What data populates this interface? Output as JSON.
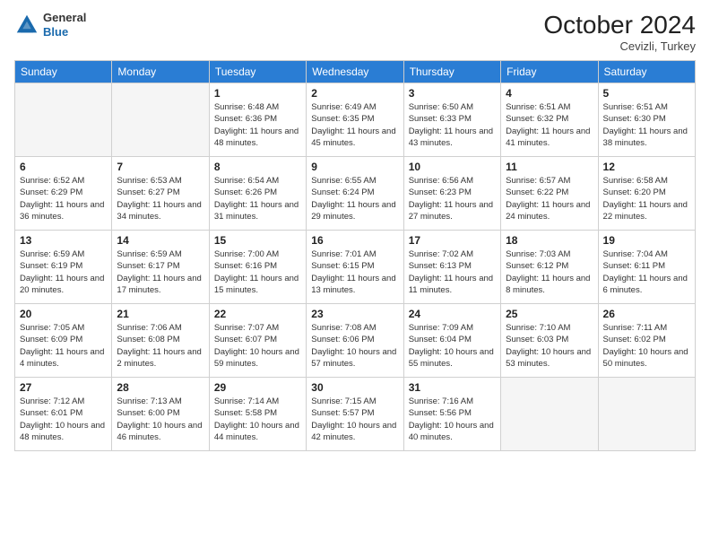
{
  "logo": {
    "general": "General",
    "blue": "Blue"
  },
  "header": {
    "month": "October 2024",
    "location": "Cevizli, Turkey"
  },
  "days_of_week": [
    "Sunday",
    "Monday",
    "Tuesday",
    "Wednesday",
    "Thursday",
    "Friday",
    "Saturday"
  ],
  "weeks": [
    [
      {
        "day": "",
        "info": ""
      },
      {
        "day": "",
        "info": ""
      },
      {
        "day": "1",
        "info": "Sunrise: 6:48 AM\nSunset: 6:36 PM\nDaylight: 11 hours and 48 minutes."
      },
      {
        "day": "2",
        "info": "Sunrise: 6:49 AM\nSunset: 6:35 PM\nDaylight: 11 hours and 45 minutes."
      },
      {
        "day": "3",
        "info": "Sunrise: 6:50 AM\nSunset: 6:33 PM\nDaylight: 11 hours and 43 minutes."
      },
      {
        "day": "4",
        "info": "Sunrise: 6:51 AM\nSunset: 6:32 PM\nDaylight: 11 hours and 41 minutes."
      },
      {
        "day": "5",
        "info": "Sunrise: 6:51 AM\nSunset: 6:30 PM\nDaylight: 11 hours and 38 minutes."
      }
    ],
    [
      {
        "day": "6",
        "info": "Sunrise: 6:52 AM\nSunset: 6:29 PM\nDaylight: 11 hours and 36 minutes."
      },
      {
        "day": "7",
        "info": "Sunrise: 6:53 AM\nSunset: 6:27 PM\nDaylight: 11 hours and 34 minutes."
      },
      {
        "day": "8",
        "info": "Sunrise: 6:54 AM\nSunset: 6:26 PM\nDaylight: 11 hours and 31 minutes."
      },
      {
        "day": "9",
        "info": "Sunrise: 6:55 AM\nSunset: 6:24 PM\nDaylight: 11 hours and 29 minutes."
      },
      {
        "day": "10",
        "info": "Sunrise: 6:56 AM\nSunset: 6:23 PM\nDaylight: 11 hours and 27 minutes."
      },
      {
        "day": "11",
        "info": "Sunrise: 6:57 AM\nSunset: 6:22 PM\nDaylight: 11 hours and 24 minutes."
      },
      {
        "day": "12",
        "info": "Sunrise: 6:58 AM\nSunset: 6:20 PM\nDaylight: 11 hours and 22 minutes."
      }
    ],
    [
      {
        "day": "13",
        "info": "Sunrise: 6:59 AM\nSunset: 6:19 PM\nDaylight: 11 hours and 20 minutes."
      },
      {
        "day": "14",
        "info": "Sunrise: 6:59 AM\nSunset: 6:17 PM\nDaylight: 11 hours and 17 minutes."
      },
      {
        "day": "15",
        "info": "Sunrise: 7:00 AM\nSunset: 6:16 PM\nDaylight: 11 hours and 15 minutes."
      },
      {
        "day": "16",
        "info": "Sunrise: 7:01 AM\nSunset: 6:15 PM\nDaylight: 11 hours and 13 minutes."
      },
      {
        "day": "17",
        "info": "Sunrise: 7:02 AM\nSunset: 6:13 PM\nDaylight: 11 hours and 11 minutes."
      },
      {
        "day": "18",
        "info": "Sunrise: 7:03 AM\nSunset: 6:12 PM\nDaylight: 11 hours and 8 minutes."
      },
      {
        "day": "19",
        "info": "Sunrise: 7:04 AM\nSunset: 6:11 PM\nDaylight: 11 hours and 6 minutes."
      }
    ],
    [
      {
        "day": "20",
        "info": "Sunrise: 7:05 AM\nSunset: 6:09 PM\nDaylight: 11 hours and 4 minutes."
      },
      {
        "day": "21",
        "info": "Sunrise: 7:06 AM\nSunset: 6:08 PM\nDaylight: 11 hours and 2 minutes."
      },
      {
        "day": "22",
        "info": "Sunrise: 7:07 AM\nSunset: 6:07 PM\nDaylight: 10 hours and 59 minutes."
      },
      {
        "day": "23",
        "info": "Sunrise: 7:08 AM\nSunset: 6:06 PM\nDaylight: 10 hours and 57 minutes."
      },
      {
        "day": "24",
        "info": "Sunrise: 7:09 AM\nSunset: 6:04 PM\nDaylight: 10 hours and 55 minutes."
      },
      {
        "day": "25",
        "info": "Sunrise: 7:10 AM\nSunset: 6:03 PM\nDaylight: 10 hours and 53 minutes."
      },
      {
        "day": "26",
        "info": "Sunrise: 7:11 AM\nSunset: 6:02 PM\nDaylight: 10 hours and 50 minutes."
      }
    ],
    [
      {
        "day": "27",
        "info": "Sunrise: 7:12 AM\nSunset: 6:01 PM\nDaylight: 10 hours and 48 minutes."
      },
      {
        "day": "28",
        "info": "Sunrise: 7:13 AM\nSunset: 6:00 PM\nDaylight: 10 hours and 46 minutes."
      },
      {
        "day": "29",
        "info": "Sunrise: 7:14 AM\nSunset: 5:58 PM\nDaylight: 10 hours and 44 minutes."
      },
      {
        "day": "30",
        "info": "Sunrise: 7:15 AM\nSunset: 5:57 PM\nDaylight: 10 hours and 42 minutes."
      },
      {
        "day": "31",
        "info": "Sunrise: 7:16 AM\nSunset: 5:56 PM\nDaylight: 10 hours and 40 minutes."
      },
      {
        "day": "",
        "info": ""
      },
      {
        "day": "",
        "info": ""
      }
    ]
  ]
}
